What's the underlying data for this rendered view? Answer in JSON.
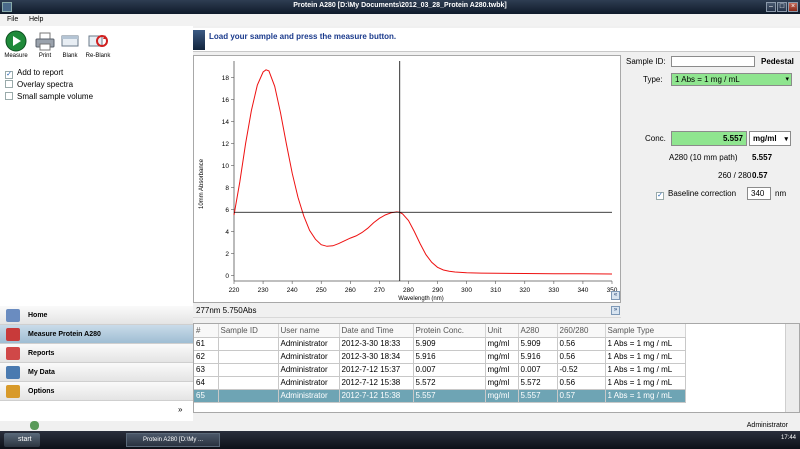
{
  "window": {
    "title": "Protein A280  [D:\\My Documents\\2012_03_28_Protein A280.twbk]"
  },
  "menu": [
    "File",
    "Help"
  ],
  "toolbar": {
    "measure": "Measure",
    "print": "Print",
    "blank": "Blank",
    "reblank": "Re-Blank"
  },
  "options": [
    {
      "label": "Add to report",
      "checked": true
    },
    {
      "label": "Overlay spectra",
      "checked": false
    },
    {
      "label": "Small sample volume",
      "checked": false
    }
  ],
  "nav": [
    {
      "label": "Home",
      "selected": false
    },
    {
      "label": "Measure Protein A280",
      "selected": true
    },
    {
      "label": "Reports",
      "selected": false
    },
    {
      "label": "My Data",
      "selected": false
    },
    {
      "label": "Options",
      "selected": false
    }
  ],
  "message": "Load your sample and press the measure button.",
  "chart_data": {
    "type": "line",
    "xlabel": "Wavelength (nm)",
    "ylabel": "10mm Absorbance",
    "xlim": [
      220,
      350
    ],
    "ylim": [
      -0.5,
      19.5
    ],
    "xticks": [
      220,
      230,
      240,
      250,
      260,
      270,
      280,
      290,
      300,
      310,
      320,
      330,
      340,
      350
    ],
    "yticks": [
      0,
      2,
      4,
      6,
      8,
      10,
      12,
      14,
      16,
      18
    ],
    "line_color": "#ee1111",
    "cursor": {
      "x": 277,
      "y": 5.75
    },
    "series": [
      {
        "x": [
          220,
          222,
          224,
          226,
          228,
          230,
          231,
          232,
          234,
          236,
          238,
          240,
          242,
          244,
          246,
          248,
          250,
          252,
          254,
          256,
          258,
          260,
          262,
          264,
          266,
          268,
          270,
          272,
          274,
          276,
          277,
          278,
          280,
          282,
          284,
          286,
          288,
          290,
          292,
          294,
          296,
          298,
          300,
          305,
          310,
          320,
          330,
          340,
          350
        ],
        "y": [
          5.5,
          8.5,
          12.0,
          15.0,
          17.3,
          18.5,
          18.7,
          18.6,
          17.2,
          14.8,
          12.0,
          9.3,
          7.1,
          5.4,
          4.1,
          3.3,
          2.8,
          2.65,
          2.7,
          2.9,
          3.15,
          3.4,
          3.6,
          3.9,
          4.3,
          4.8,
          5.2,
          5.5,
          5.7,
          5.78,
          5.75,
          5.6,
          5.0,
          4.0,
          2.9,
          1.9,
          1.2,
          0.75,
          0.5,
          0.38,
          0.32,
          0.28,
          0.25,
          0.22,
          0.2,
          0.18,
          0.16,
          0.15,
          0.14
        ]
      }
    ]
  },
  "cursor_readout": "277nm  5.750Abs",
  "panel": {
    "sample_id_label": "Sample ID:",
    "sample_id_value": "",
    "pedestal": "Pedestal",
    "type_label": "Type:",
    "type_value": "1 Abs = 1 mg / mL",
    "conc_label": "Conc.",
    "conc_value": "5.557",
    "conc_unit": "mg/ml",
    "a280_label": "A280 (10 mm path)",
    "a280_value": "5.557",
    "ratio_label": "260 / 280",
    "ratio_value": "0.57",
    "baseline_label": "Baseline correction",
    "baseline_checked": true,
    "baseline_value": "340",
    "baseline_unit": "nm"
  },
  "table": {
    "headers": [
      "#",
      "Sample ID",
      "User name",
      "Date and Time",
      "Protein Conc.",
      "Unit",
      "A280",
      "260/280",
      "Sample Type"
    ],
    "rows": [
      [
        "61",
        "",
        "Administrator",
        "2012-3-30 18:33",
        "5.909",
        "mg/ml",
        "5.909",
        "0.56",
        "1 Abs = 1 mg / mL"
      ],
      [
        "62",
        "",
        "Administrator",
        "2012-3-30 18:34",
        "5.916",
        "mg/ml",
        "5.916",
        "0.56",
        "1 Abs = 1 mg / mL"
      ],
      [
        "63",
        "",
        "Administrator",
        "2012-7-12 15:37",
        "0.007",
        "mg/ml",
        "0.007",
        "-0.52",
        "1 Abs = 1 mg / mL"
      ],
      [
        "64",
        "",
        "Administrator",
        "2012-7-12 15:38",
        "5.572",
        "mg/ml",
        "5.572",
        "0.56",
        "1 Abs = 1 mg / mL"
      ],
      [
        "65",
        "",
        "Administrator",
        "2012-7-12 15:38",
        "5.557",
        "mg/ml",
        "5.557",
        "0.57",
        "1 Abs = 1 mg / mL"
      ]
    ],
    "selected_row": 4
  },
  "status": {
    "user": "Administrator"
  },
  "taskbar": {
    "start": "start",
    "app": "Protein A280  [D:\\My ...",
    "clock": "17:44"
  },
  "colors": {
    "accent_green": "#8fe58f",
    "selection": "#6ea4b4",
    "message_text": "#1a3a8c"
  }
}
